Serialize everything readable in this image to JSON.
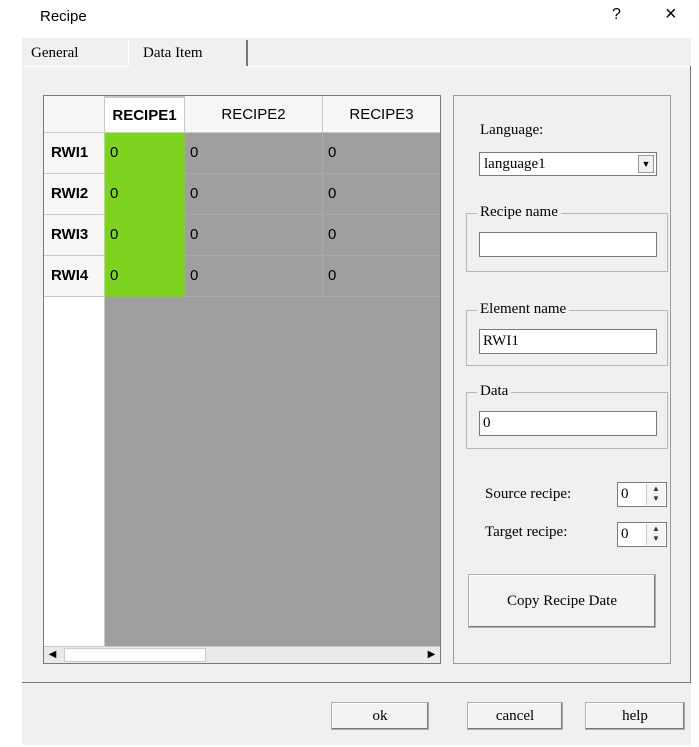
{
  "window": {
    "title": "Recipe",
    "help_glyph": "?",
    "close_glyph": "×"
  },
  "tabs": [
    {
      "label": "General",
      "selected": false
    },
    {
      "label": "Data Item",
      "selected": true
    }
  ],
  "grid": {
    "columns": [
      "RECIPE1",
      "RECIPE2",
      "RECIPE3"
    ],
    "rows": [
      {
        "label": "RWI1",
        "values": [
          "0",
          "0",
          "0"
        ]
      },
      {
        "label": "RWI2",
        "values": [
          "0",
          "0",
          "0"
        ]
      },
      {
        "label": "RWI3",
        "values": [
          "0",
          "0",
          "0"
        ]
      },
      {
        "label": "RWI4",
        "values": [
          "0",
          "0",
          "0"
        ]
      }
    ],
    "selected_column": "RECIPE1",
    "highlight_color": "#7ed321",
    "scroll_left_glyph": "◀",
    "scroll_right_glyph": "▶"
  },
  "panel": {
    "language_label": "Language:",
    "language_value": "language1",
    "recipe_name_label": "Recipe name",
    "recipe_name_value": "",
    "element_name_label": "Element name",
    "element_name_value": "RWI1",
    "data_label": "Data",
    "data_value": "0",
    "source_recipe_label": "Source recipe:",
    "source_recipe_value": "0",
    "target_recipe_label": "Target recipe:",
    "target_recipe_value": "0",
    "copy_button": "Copy Recipe Date"
  },
  "footer": {
    "ok": "ok",
    "cancel": "cancel",
    "help": "help"
  }
}
